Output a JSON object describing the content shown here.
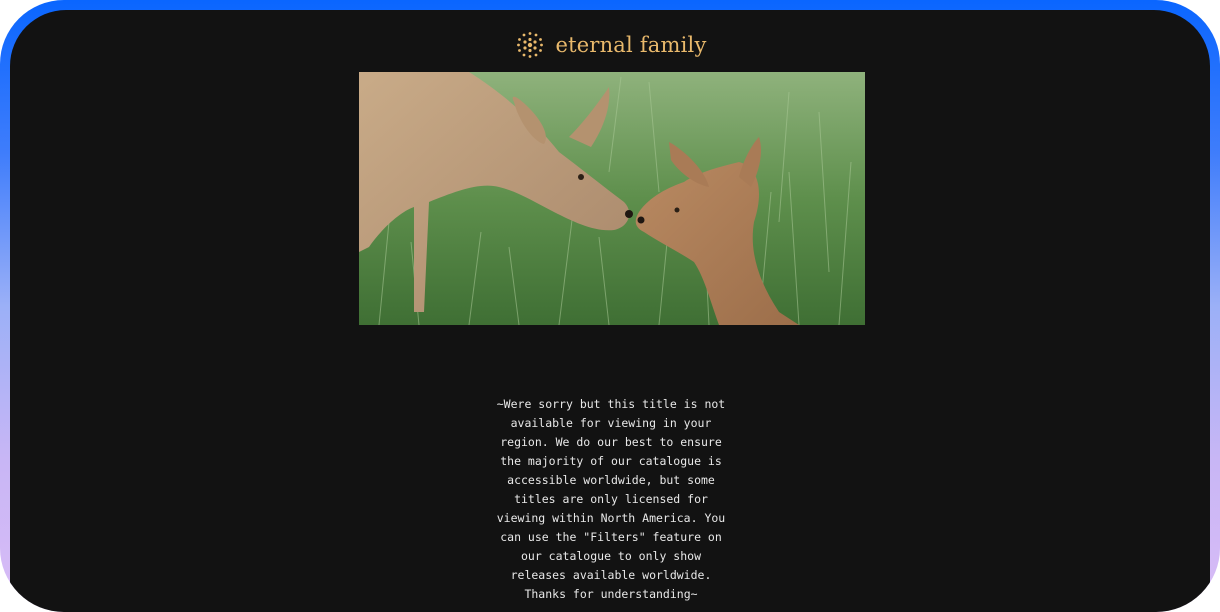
{
  "brand": {
    "name": "eternal family",
    "logo_icon": "sunburst-dots-icon",
    "color": "#e9b96c"
  },
  "hero": {
    "image_icon": "deer-kissing-fawn-image"
  },
  "notice": {
    "text": "~Were sorry but this title is not available for viewing in your region. We do our best to ensure the majority of our catalogue is accessible worldwide, but some titles are only licensed for viewing within North America. You can use the \"Filters\" feature on our catalogue to only show releases available worldwide. Thanks for understanding~"
  },
  "colors": {
    "background": "#121212",
    "frame_top": "#0a66ff",
    "frame_bottom": "#d9bcf6",
    "text": "#e8e8e8"
  }
}
